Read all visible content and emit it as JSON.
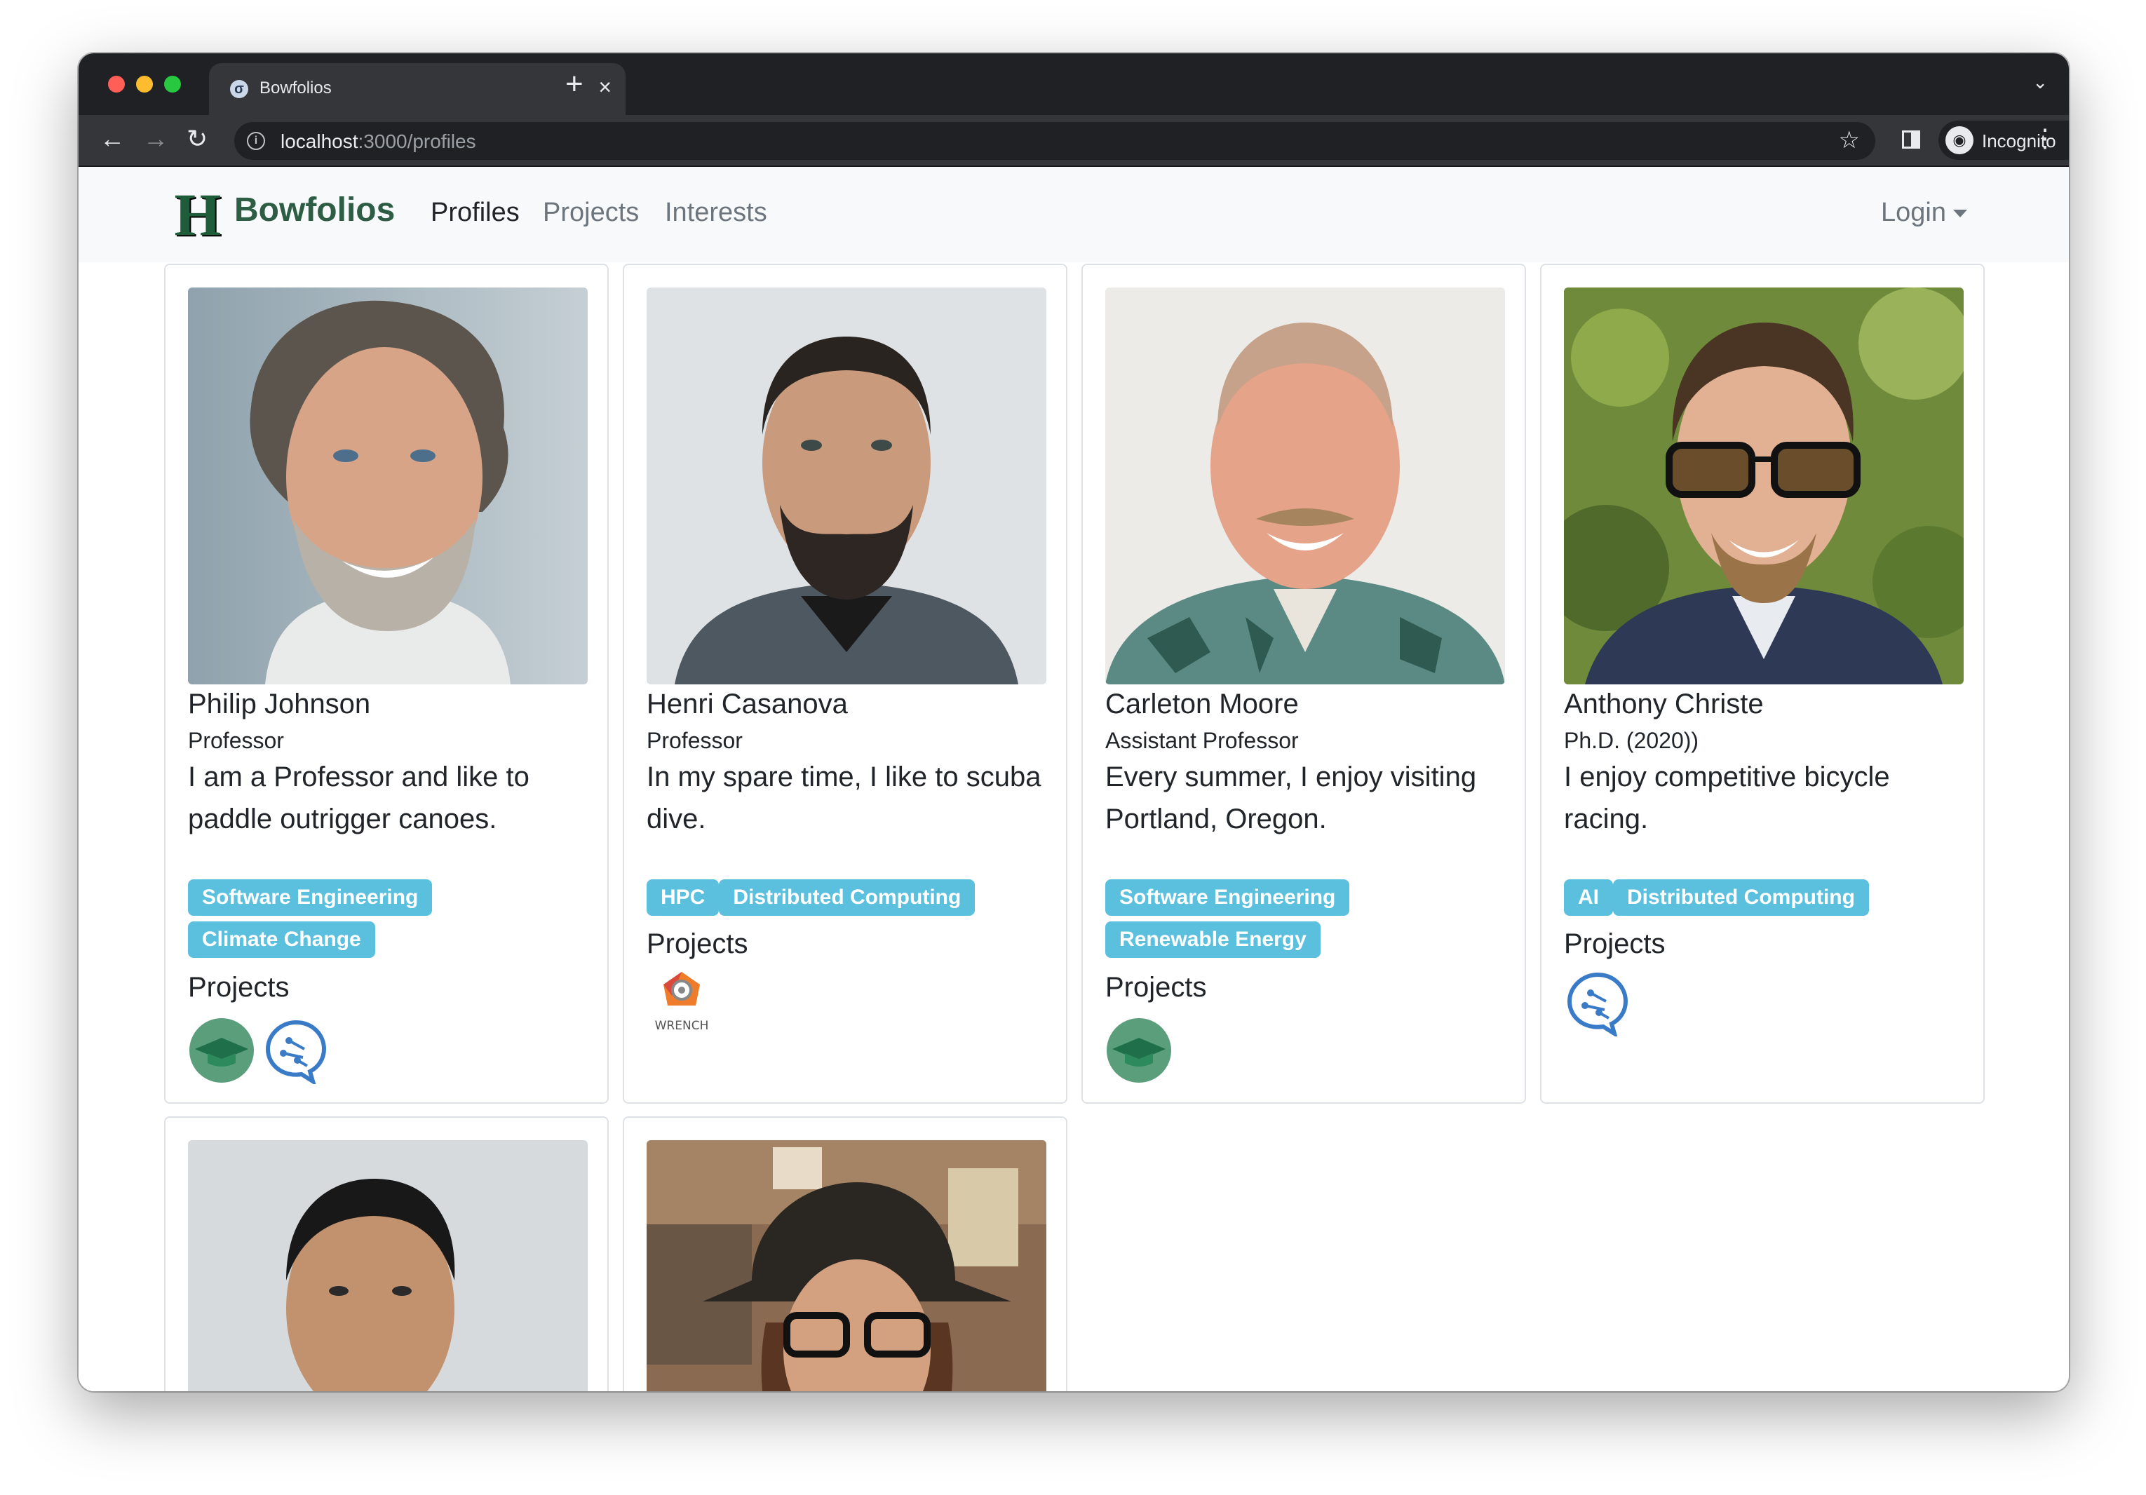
{
  "browser": {
    "tab_title": "Bowfolios",
    "url_host": "localhost",
    "url_rest": ":3000/profiles",
    "profile_label": "Incognito"
  },
  "site": {
    "brand": "Bowfolios",
    "nav": {
      "profiles": "Profiles",
      "projects": "Projects",
      "interests": "Interests"
    },
    "login": "Login"
  },
  "profiles": [
    {
      "name": "Philip Johnson",
      "title": "Professor",
      "bio": "I am a Professor and like to paddle outrigger canoes.",
      "interests": [
        "Software Engineering",
        "Climate Change"
      ],
      "projects_heading": "Projects",
      "projects": [
        "graduation-cap-logo",
        "chat-circuit-logo"
      ]
    },
    {
      "name": "Henri Casanova",
      "title": "Professor",
      "bio": "In my spare time, I like to scuba dive.",
      "interests": [
        "HPC",
        "Distributed Computing"
      ],
      "projects_heading": "Projects",
      "projects": [
        "wrench-logo"
      ],
      "project_caption": "WRENCH"
    },
    {
      "name": "Carleton Moore",
      "title": "Assistant Professor",
      "bio": "Every summer, I enjoy visiting Portland, Oregon.",
      "interests": [
        "Software Engineering",
        "Renewable Energy"
      ],
      "projects_heading": "Projects",
      "projects": [
        "graduation-cap-logo"
      ]
    },
    {
      "name": "Anthony Christe",
      "title": "Ph.D. (2020))",
      "bio": "I enjoy competitive bicycle racing.",
      "interests": [
        "AI",
        "Distributed Computing"
      ],
      "projects_heading": "Projects",
      "projects": [
        "chat-circuit-logo"
      ]
    }
  ],
  "colors": {
    "badge": "#5bc0de",
    "brand_green": "#2e5d45",
    "navbar_bg": "#f8f9fa"
  }
}
